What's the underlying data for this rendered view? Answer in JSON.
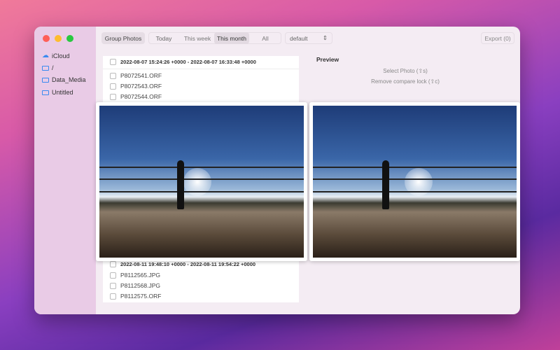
{
  "sidebar": {
    "items": [
      {
        "label": "iCloud",
        "icon": "cloud-icon"
      },
      {
        "label": "/",
        "icon": "folder-icon"
      },
      {
        "label": "Data_Media",
        "icon": "folder-icon"
      },
      {
        "label": "Untitled",
        "icon": "folder-icon"
      }
    ]
  },
  "toolbar": {
    "group": "Group Photos",
    "filters": [
      "Today",
      "This week",
      "This month",
      "All"
    ],
    "selected_filter": "This month",
    "sort": "default",
    "export": "Export (0)"
  },
  "groups": [
    {
      "header": "2022-08-07 15:24:26 +0000 - 2022-08-07 16:33:48 +0000",
      "files": [
        "P8072541.ORF",
        "P8072543.ORF",
        "P8072544.ORF"
      ]
    },
    {
      "header": "2022-08-11 19:48:10 +0000 - 2022-08-11 19:54:22 +0000",
      "files": [
        "P8112565.JPG",
        "P8112568.JPG",
        "P8112575.ORF"
      ]
    }
  ],
  "preview": {
    "title": "Preview",
    "select": "Select Photo (⇧s)",
    "remove": "Remove compare lock (⇧c)"
  }
}
